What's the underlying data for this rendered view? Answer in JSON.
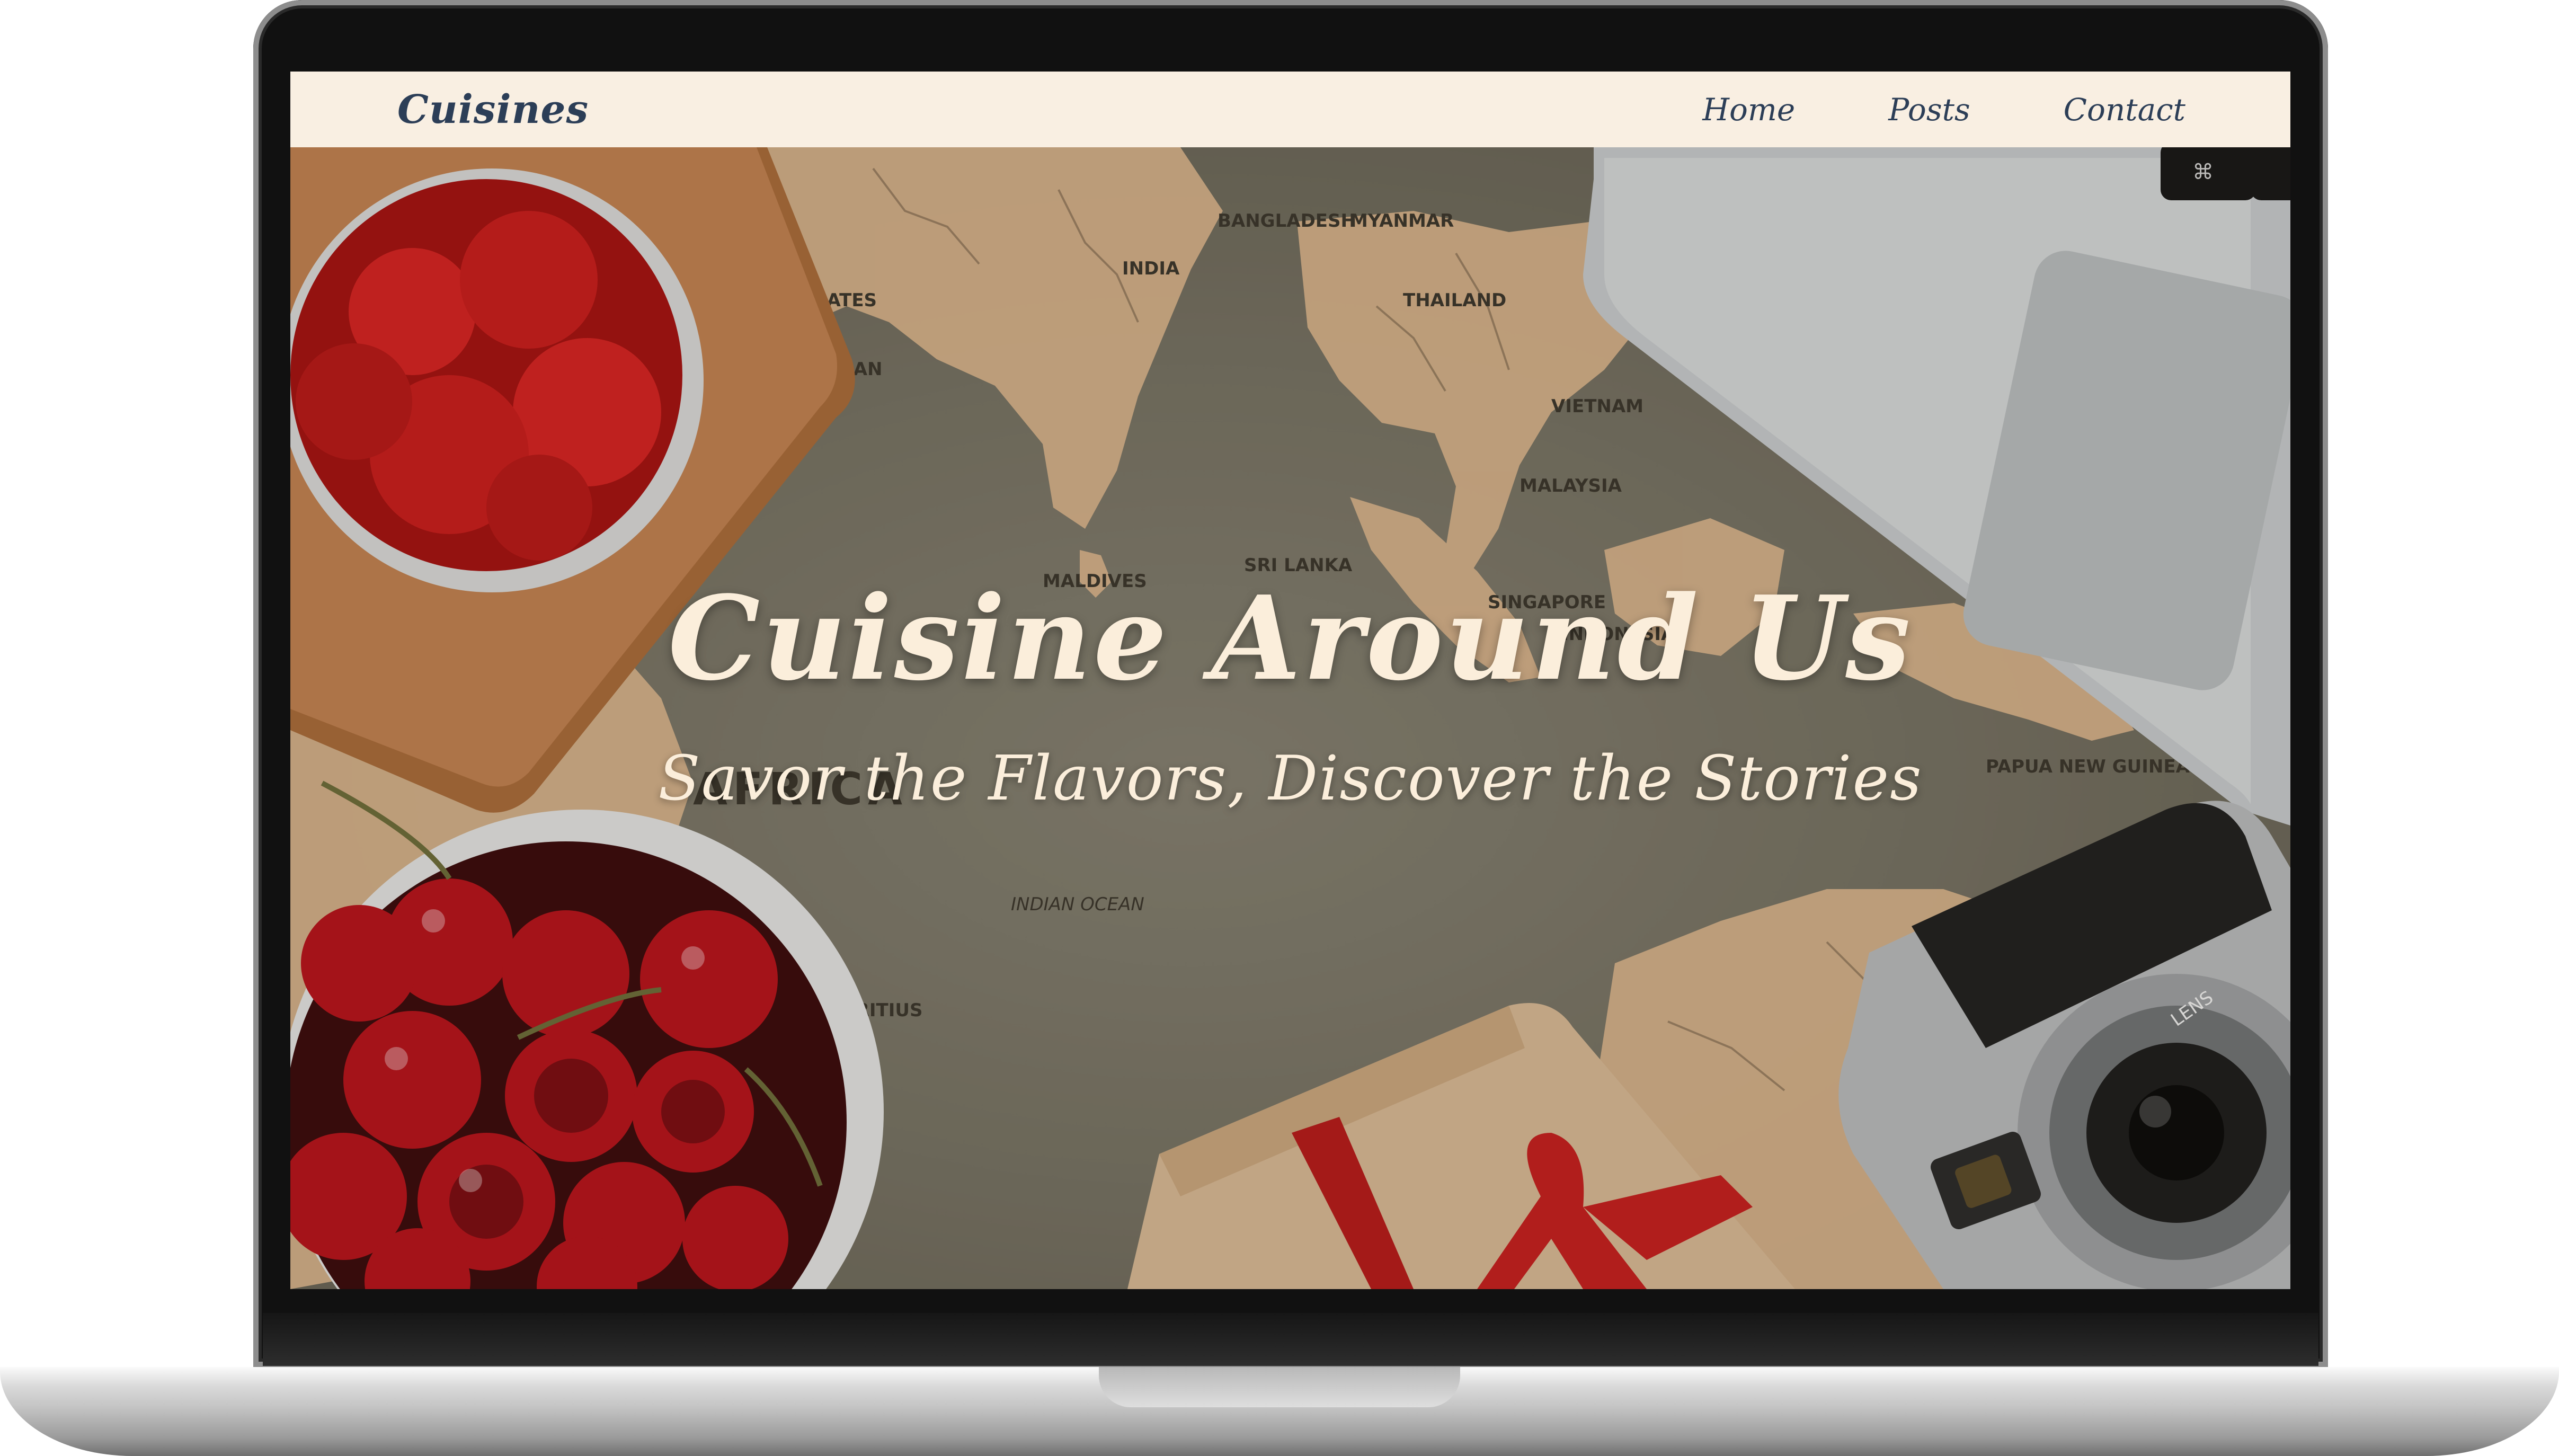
{
  "nav": {
    "brand": "Cuisines",
    "links": [
      {
        "label": "Home"
      },
      {
        "label": "Posts"
      },
      {
        "label": "Contact"
      }
    ]
  },
  "hero": {
    "title": "Cuisine Around Us",
    "subtitle": "Savor the Flavors, Discover the Stories",
    "background_labels": [
      "INDIA",
      "BANGLADESH",
      "MYANMAR",
      "THAILAND",
      "VIETNAM",
      "MALAYSIA",
      "SINGAPORE",
      "INDONESIA",
      "SRI LANKA",
      "MALDIVES",
      "AFRICA",
      "INDIAN OCEAN",
      "PAPUA NEW GUINEA",
      "ARAB EMIRATES",
      "OMAN",
      "MAURITIUS",
      "LENS"
    ]
  },
  "colors": {
    "navbar_bg": "#f9efe2",
    "nav_text": "#2c3e57",
    "hero_text": "#fbeedb",
    "map_bg": "#757163",
    "land": "#d9b48c",
    "strawberry": "#c81c1c",
    "cherry": "#a8121a"
  }
}
